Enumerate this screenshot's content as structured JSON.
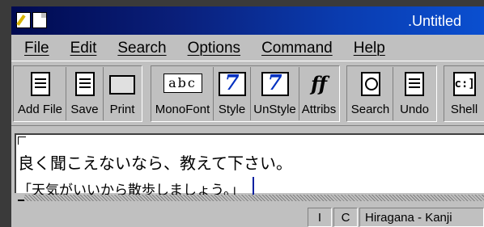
{
  "window": {
    "title": ".Untitled"
  },
  "menu": [
    "File",
    "Edit",
    "Search",
    "Options",
    "Command",
    "Help"
  ],
  "toolbar": {
    "add_file": "Add File",
    "save": "Save",
    "print": "Print",
    "monofont": "MonoFont",
    "monofont_glyph": "abc",
    "style": "Style",
    "unstyle": "UnStyle",
    "attribs": "Attribs",
    "attribs_glyph": "ff",
    "search": "Search",
    "undo": "Undo",
    "shell": "Shell",
    "shell_glyph": "c:]"
  },
  "editor": {
    "line1": "良く聞こえないなら、教えて下さい。",
    "line2": "「天気がいいから散歩しましょう。」"
  },
  "status": {
    "cell1": "I",
    "cell2": "C",
    "mode": "Hiragana - Kanji"
  }
}
